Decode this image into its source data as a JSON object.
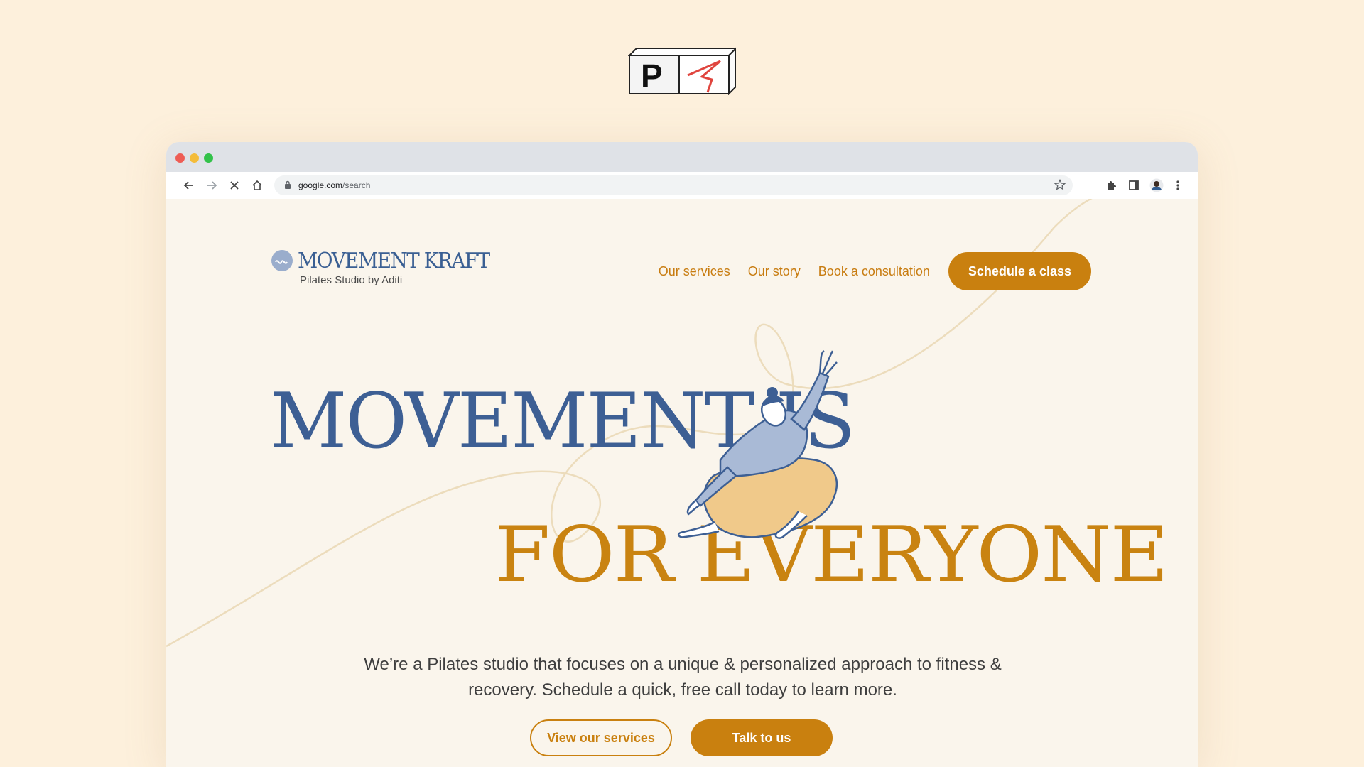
{
  "top_logo": {
    "letter": "P"
  },
  "browser": {
    "address": {
      "host": "google.com",
      "path": "/search"
    }
  },
  "site": {
    "brand": {
      "name": "MOVEMENT KRAFT",
      "tagline": "Pilates Studio by Aditi"
    },
    "nav": {
      "links": [
        "Our services",
        "Our story",
        "Book a consultation"
      ],
      "cta": "Schedule a class"
    },
    "hero": {
      "line1": "MOVEMENT IS",
      "line2": "FOR EVERYONE",
      "description": "We’re a Pilates studio that focuses on a unique & personalized approach to fitness & recovery.  Schedule a quick, free call today to learn more.",
      "secondary_button": "View our services",
      "primary_button": "Talk to us"
    }
  },
  "colors": {
    "background": "#fdf0dc",
    "accent_orange": "#c9800f",
    "brand_blue": "#3d5f94"
  }
}
